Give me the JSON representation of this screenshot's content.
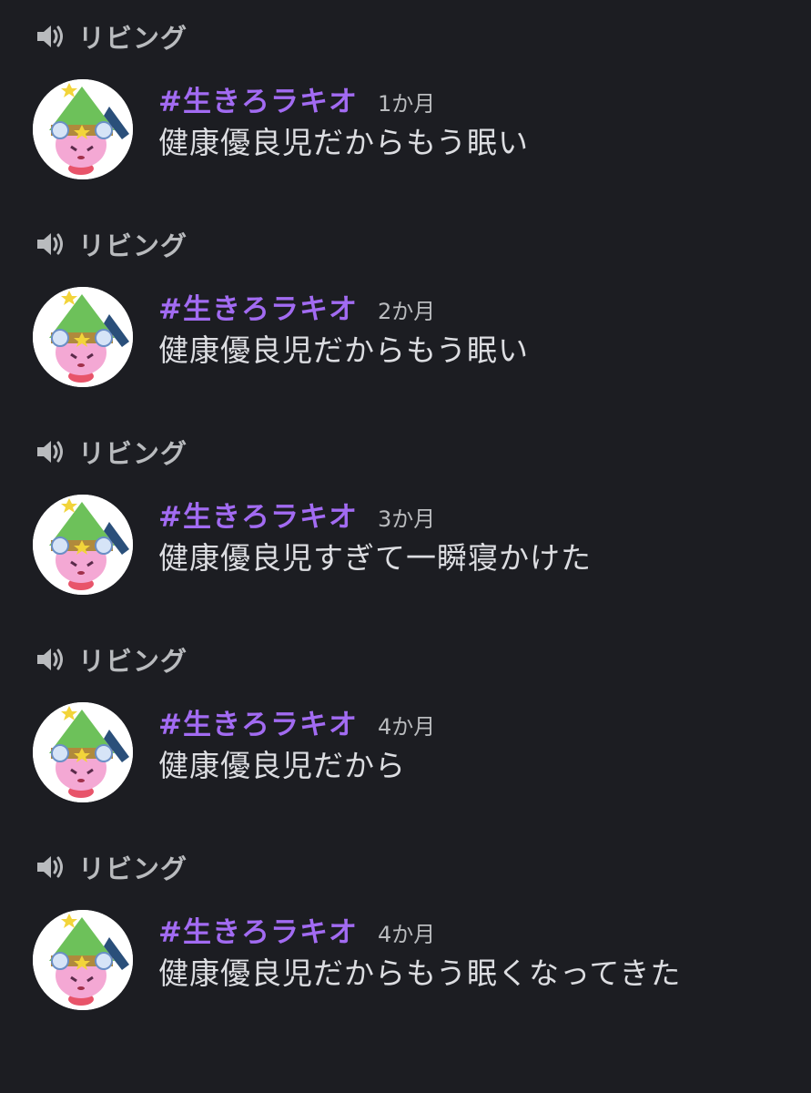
{
  "colors": {
    "background": "#1c1d22",
    "username": "#a26bf2",
    "channel": "#b9bbbe",
    "text": "#dcdde1"
  },
  "icons": {
    "channel": "speaker-icon"
  },
  "entries": [
    {
      "channel": "リビング",
      "username": "#生きろラキオ",
      "time": "1か月",
      "text": "健康優良児だからもう眠い"
    },
    {
      "channel": "リビング",
      "username": "#生きろラキオ",
      "time": "2か月",
      "text": "健康優良児だからもう眠い"
    },
    {
      "channel": "リビング",
      "username": "#生きろラキオ",
      "time": "3か月",
      "text": "健康優良児すぎて一瞬寝かけた"
    },
    {
      "channel": "リビング",
      "username": "#生きろラキオ",
      "time": "4か月",
      "text": "健康優良児だから"
    },
    {
      "channel": "リビング",
      "username": "#生きろラキオ",
      "time": "4か月",
      "text": "健康優良児だからもう眠くなってきた"
    }
  ]
}
